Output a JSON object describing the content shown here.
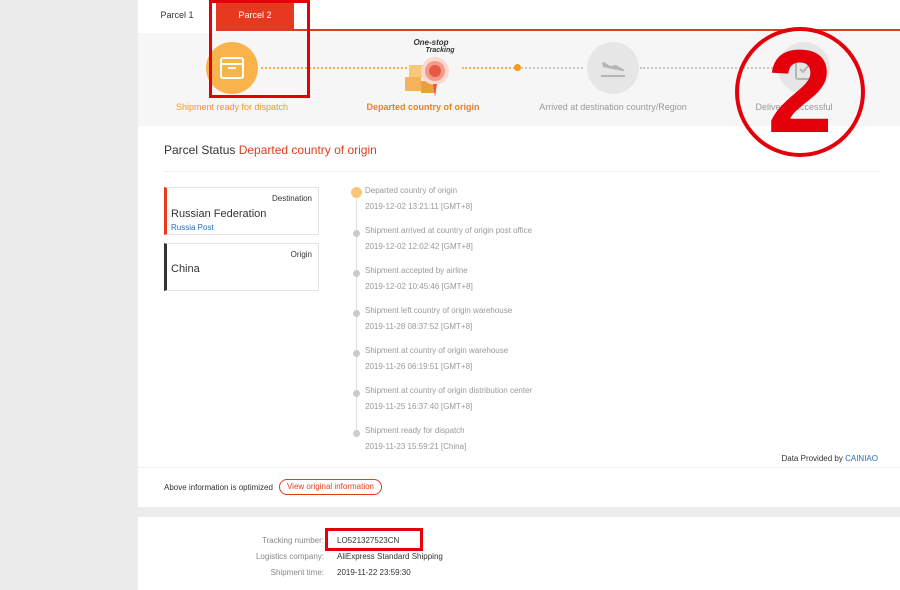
{
  "tabs": [
    "Parcel 1",
    "Parcel 2"
  ],
  "progress": {
    "badge_line1": "One-stop",
    "badge_line2": "Tracking",
    "steps": [
      {
        "label": "Shipment ready for dispatch",
        "icon": "box-icon",
        "state": "done"
      },
      {
        "label": "Departed country of origin",
        "icon": "parcel-tracking-icon",
        "state": "current"
      },
      {
        "label": "Arrived at destination country/Region",
        "icon": "airplane-landing-icon",
        "state": "pending"
      },
      {
        "label": "Delivery successful",
        "icon": "clipboard-check-icon",
        "state": "pending"
      }
    ]
  },
  "annotation": {
    "number": "2"
  },
  "status": {
    "label": "Parcel Status",
    "value": "Departed country of origin"
  },
  "destination": {
    "kind": "Destination",
    "country": "Russian Federation",
    "carrier": "Russia Post"
  },
  "origin": {
    "kind": "Origin",
    "country": "China"
  },
  "timeline": [
    {
      "desc": "Departed country of origin",
      "time": "2019-12-02 13:21:11 [GMT+8]"
    },
    {
      "desc": "Shipment arrived at country of origin post office",
      "time": "2019-12-02 12:02:42 [GMT+8]"
    },
    {
      "desc": "Shipment accepted by airline",
      "time": "2019-12-02 10:45:46 [GMT+8]"
    },
    {
      "desc": "Shipment left country of origin warehouse",
      "time": "2019-11-28 08:37:52 [GMT+8]"
    },
    {
      "desc": "Shipment at country of origin warehouse",
      "time": "2019-11-26 06:19:51 [GMT+8]"
    },
    {
      "desc": "Shipment at country of origin distribution center",
      "time": "2019-11-25 16:37:40 [GMT+8]"
    },
    {
      "desc": "Shipment ready for dispatch",
      "time": "2019-11-23 15:59:21 [China]"
    }
  ],
  "provided": {
    "prefix": "Data Provided by",
    "link": "CAINIAO"
  },
  "footer": {
    "optimized": "Above information is optimized",
    "view_button": "View original information"
  },
  "shipment": {
    "tracking_label": "Tracking number:",
    "tracking_value": "LO521327523CN",
    "logistics_label": "Logistics company:",
    "logistics_value": "AliExpress Standard Shipping",
    "time_label": "Shipment time:",
    "time_value": "2019-11-22 23:59:30"
  },
  "colors": {
    "accent": "#e53a1f",
    "progress_orange": "#f8b44a",
    "annotation_red": "#e3000b",
    "link_blue": "#2a6ebb"
  }
}
